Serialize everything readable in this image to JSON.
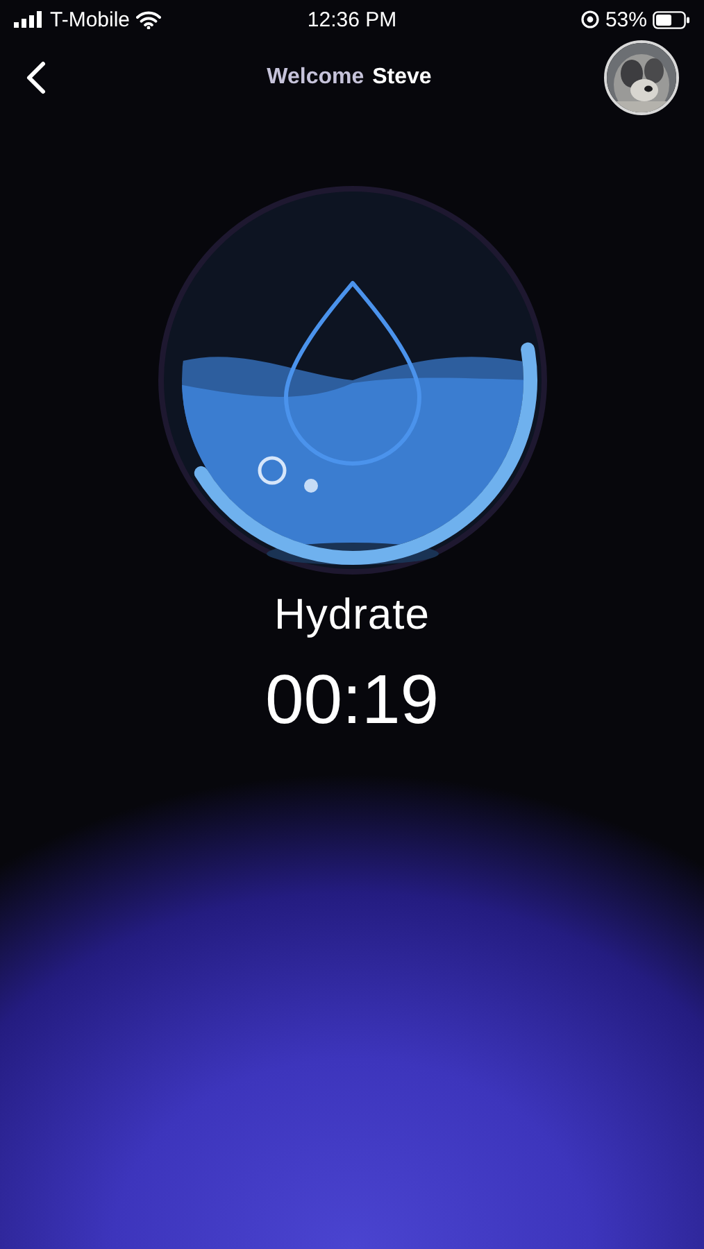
{
  "status_bar": {
    "carrier": "T-Mobile",
    "time": "12:36 PM",
    "battery": "53%"
  },
  "header": {
    "greeting": "Welcome",
    "user_name": "Steve"
  },
  "activity": {
    "name": "Hydrate",
    "timer": "00:19",
    "progress": {
      "level": 0.44
    }
  }
}
